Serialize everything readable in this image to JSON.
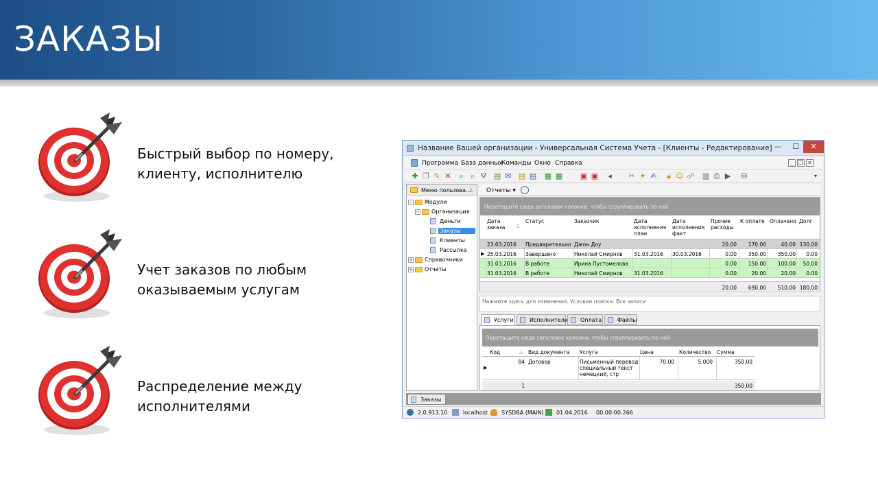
{
  "slide": {
    "title": "ЗАКАЗЫ",
    "bullets": [
      {
        "icon": "target-icon",
        "line1": "Быстрый выбор по номеру,",
        "line2": "клиенту, исполнителю"
      },
      {
        "icon": "target-icon",
        "line1": "Учет заказов по любым",
        "line2": "оказываемым услугам"
      },
      {
        "icon": "target-icon",
        "line1": "Распределение между",
        "line2": "исполнителями"
      }
    ]
  },
  "window": {
    "title": "Название Вашей организации - Универсальная Система Учета - [Клиенты - Редактирование] - [З...",
    "buttons": {
      "minimize": "—",
      "maximize": "☐",
      "close": "✕"
    },
    "menu": [
      "Программа",
      "База данных",
      "Команды",
      "Окно",
      "Справка"
    ],
    "mdi_buttons": [
      "_",
      "❐",
      "✕"
    ],
    "left_panel": {
      "header": "Меню пользова...",
      "tree": [
        {
          "label": "Модули",
          "level": 0,
          "type": "folder"
        },
        {
          "label": "Организация",
          "level": 1,
          "type": "folder"
        },
        {
          "label": "Деньги",
          "level": 2,
          "type": "doc"
        },
        {
          "label": "Заказы",
          "level": 2,
          "type": "doc",
          "selected": true
        },
        {
          "label": "Клиенты",
          "level": 2,
          "type": "doc"
        },
        {
          "label": "Рассылка",
          "level": 2,
          "type": "doc"
        },
        {
          "label": "Справочники",
          "level": 0,
          "type": "folder"
        },
        {
          "label": "Отчеты",
          "level": 0,
          "type": "folder"
        }
      ]
    },
    "reports_button": "Отчеты ▾",
    "orders_grid": {
      "group_hint": "Перетащите сюда заголовок колонки, чтобы сгруппировать по ней",
      "columns": [
        "Дата\nзаказа",
        "Статус",
        "Заказчик",
        "Дата\nисполнения\nплан",
        "Дата\nисполнения\nфакт",
        "Прочие\nрасходы",
        "К оплате",
        "Оплачено",
        "Долг"
      ],
      "rows": [
        {
          "date": "23.03.2016",
          "status": "Предварительно",
          "customer": "Джон Доу",
          "plan": "",
          "fact": "",
          "other": "20.00",
          "to_pay": "170.00",
          "paid": "40.00",
          "debt": "130.00",
          "color": "#d2d2d2"
        },
        {
          "date": "25.03.2016",
          "status": "Завершено",
          "customer": "Николай Смирнов",
          "plan": "31.03.2016",
          "fact": "30.03.2016",
          "other": "0.00",
          "to_pay": "350.00",
          "paid": "350.00",
          "debt": "0.00",
          "color": "#ffffff"
        },
        {
          "date": "31.03.2016",
          "status": "В работе",
          "customer": "Ирина Пустомелова",
          "plan": "",
          "fact": "",
          "other": "0.00",
          "to_pay": "150.00",
          "paid": "100.00",
          "debt": "50.00",
          "color": "#c9f5c1"
        },
        {
          "date": "31.03.2016",
          "status": "В работе",
          "customer": "Николай Смирнов",
          "plan": "31.03.2016",
          "fact": "",
          "other": "0.00",
          "to_pay": "20.00",
          "paid": "20.00",
          "debt": "0.00",
          "color": "#c9f5c1"
        }
      ],
      "totals": {
        "other": "20.00",
        "to_pay": "690.00",
        "paid": "510.00",
        "debt": "180.00"
      }
    },
    "filter_text": "Нажмите здесь для изменения. Условие поиска: Все записи",
    "sub_tabs": [
      "Услуги",
      "Исполнители",
      "Оплата",
      "Файлы"
    ],
    "services_grid": {
      "group_hint": "Перетащите сюда заголовок колонки, чтобы сгруппировать по ней",
      "columns": [
        "Код",
        "Вид документа",
        "Услуга",
        "Цена",
        "Количество",
        "Сумма"
      ],
      "row": {
        "code": "84",
        "doc_type": "Договор",
        "service_l1": "Письменный перевод",
        "service_l2": "специальный текст",
        "service_l3": "немецкий, стр",
        "price": "70.00",
        "qty": "5.000",
        "sum": "350.00"
      },
      "totals": {
        "count": "1",
        "sum": "350.00"
      }
    },
    "bottom_tab": "Заказы",
    "status": {
      "version": "2.0.913.10",
      "host": "localhost",
      "user": "SYSDBA (MAIN)",
      "date": "01.04.2016",
      "timer": "00:00:00:266"
    }
  }
}
